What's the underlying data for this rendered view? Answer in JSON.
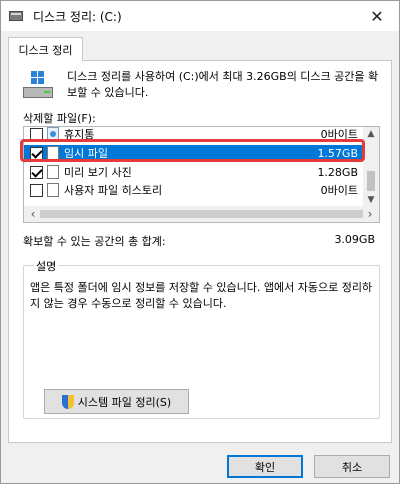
{
  "window": {
    "title": "디스크 정리: (C:)",
    "close_glyph": "✕"
  },
  "tab": {
    "label": "디스크 정리"
  },
  "summary": {
    "text": "디스크 정리를 사용하여 (C:)에서 최대 3.26GB의 디스크 공간을 확보할 수 있습니다."
  },
  "files": {
    "label": "삭제할 파일(F):",
    "items": [
      {
        "name": "휴지통",
        "size": "0바이트",
        "checked": false,
        "icon": "recycle-bin-icon"
      },
      {
        "name": "임시 파일",
        "size": "1.57GB",
        "checked": true,
        "selected": true,
        "icon": "file-icon"
      },
      {
        "name": "미리 보기 사진",
        "size": "1.28GB",
        "checked": true,
        "icon": "file-icon"
      },
      {
        "name": "사용자 파일 히스토리",
        "size": "0바이트",
        "checked": false,
        "icon": "file-icon"
      }
    ]
  },
  "total": {
    "label": "확보할 수 있는 공간의 총 합계:",
    "value": "3.09GB"
  },
  "description": {
    "title": "설명",
    "text": "앱은 특정 폴더에 임시 정보를 저장할 수 있습니다. 앱에서 자동으로 정리하지 않는 경우 수동으로 정리할 수 있습니다."
  },
  "buttons": {
    "system_cleanup": "시스템 파일 정리(S)",
    "ok": "확인",
    "cancel": "취소"
  },
  "colors": {
    "selection": "#0078d7",
    "highlight": "#e43b3b",
    "accent": "#0078d7"
  }
}
